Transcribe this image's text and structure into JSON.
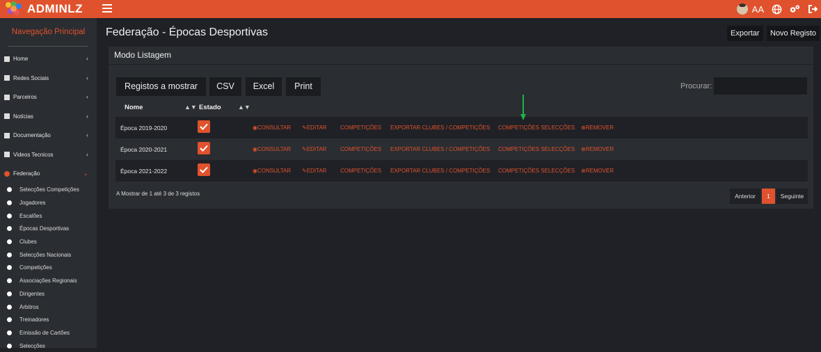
{
  "app": {
    "title": "ADMINLZ",
    "user_initials": "AA"
  },
  "colors": {
    "accent": "#e0522d",
    "bg": "#1f2126",
    "panel": "#2a2d32"
  },
  "sidebar": {
    "title": "Navegação Principal",
    "items": [
      {
        "label": "Home",
        "icon": "home-icon"
      },
      {
        "label": "Redes Sociais",
        "icon": "share-icon"
      },
      {
        "label": "Parceiros",
        "icon": "handshake-icon"
      },
      {
        "label": "Notícias",
        "icon": "news-icon"
      },
      {
        "label": "Documentação",
        "icon": "document-icon"
      },
      {
        "label": "Videos Tecnicos",
        "icon": "video-icon"
      },
      {
        "label": "Federação",
        "icon": "ball-icon"
      }
    ],
    "subitems": [
      "Selecções Competições",
      "Jogadores",
      "Escalões",
      "Épocas Desportivas",
      "Clubes",
      "Selecções Nacionais",
      "Competições",
      "Associações Regionais",
      "Dirigentes",
      "Arbitros",
      "Treinadores",
      "Emissão de Cartões",
      "Selecções"
    ]
  },
  "page": {
    "title": "Federação - Épocas Desportivas",
    "export_label": "Exportar",
    "new_label": "Novo Registo"
  },
  "panel": {
    "title": "Modo Listagem",
    "buttons": {
      "show": "Registos a mostrar",
      "csv": "CSV",
      "excel": "Excel",
      "print": "Print"
    },
    "search_label": "Procurar:",
    "columns": {
      "name": "Nome",
      "state": "Estado"
    },
    "actions": {
      "consult": "CONSULTAR",
      "edit": "EDITAR",
      "competitions": "COMPETIÇÕES",
      "export_clubs": "EXPORTAR CLUBES / COMPETIÇÕES",
      "selection_competitions": "COMPETIÇÕES SELECÇÕES",
      "remove": "REMOVER"
    },
    "rows": [
      {
        "name": "Época 2019-2020",
        "active": true
      },
      {
        "name": "Época 2020-2021",
        "active": true
      },
      {
        "name": "Época 2021-2022",
        "active": true
      }
    ],
    "info": "A Mostrar de 1 até 3 de 3 registos",
    "pagination": {
      "prev": "Anterior",
      "current": "1",
      "next": "Seguinte"
    }
  }
}
